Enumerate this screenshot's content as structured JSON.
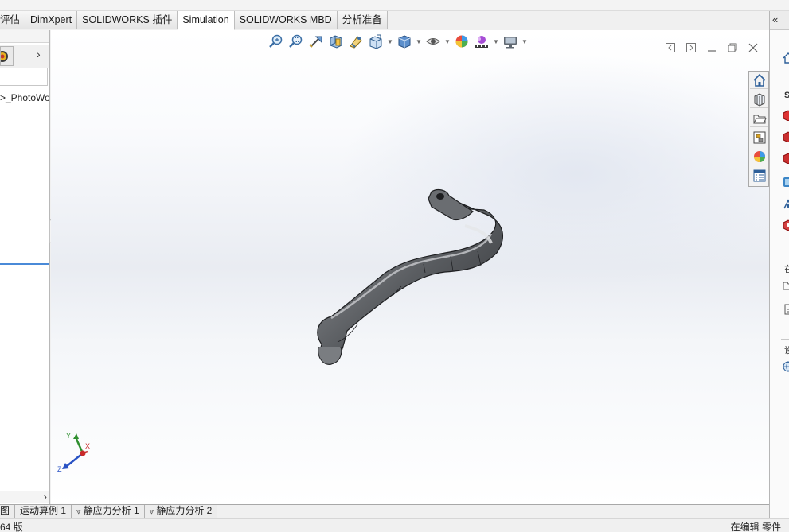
{
  "tabs": [
    {
      "label": "评估",
      "active": false
    },
    {
      "label": "DimXpert",
      "active": false
    },
    {
      "label": "SOLIDWORKS 插件",
      "active": false
    },
    {
      "label": "Simulation",
      "active": true
    },
    {
      "label": "SOLIDWORKS MBD",
      "active": false
    },
    {
      "label": "分析准备",
      "active": false
    }
  ],
  "feature_manager": {
    "tree_item": ">_PhotoWo"
  },
  "bottom_tabs": [
    {
      "label": "图"
    },
    {
      "label": "运动算例 1"
    },
    {
      "label": "静应力分析 1"
    },
    {
      "label": "静应力分析 2"
    }
  ],
  "status_bar": {
    "left": "64 版",
    "right": "在编辑 零件"
  },
  "triad": {
    "x": "X",
    "y": "Y",
    "z": "Z"
  },
  "task_pane": {
    "letters": [
      "S",
      "在",
      "设"
    ]
  },
  "colors": {
    "accent": "#4a8ad8",
    "part": "#6b6e72",
    "tabbar": "#f0f0f0"
  }
}
